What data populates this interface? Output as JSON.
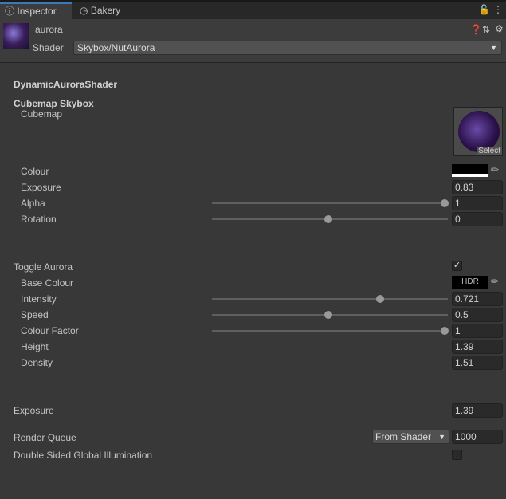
{
  "tabs": [
    {
      "label": "Inspector",
      "icon": "info-icon"
    },
    {
      "label": "Bakery",
      "icon": "bakery-icon"
    }
  ],
  "header": {
    "name": "aurora",
    "shader_label": "Shader",
    "shader_value": "Skybox/NutAurora"
  },
  "sections": {
    "title": "DynamicAuroraShader",
    "cubemap_skybox": "Cubemap Skybox",
    "cubemap": "Cubemap",
    "select": "Select"
  },
  "props": {
    "colour": {
      "label": "Colour",
      "color": "#000000"
    },
    "exposure": {
      "label": "Exposure",
      "value": "0.83"
    },
    "alpha": {
      "label": "Alpha",
      "value": "1",
      "fraction": 1
    },
    "rotation": {
      "label": "Rotation",
      "value": "0",
      "fraction": 0.5
    },
    "toggle_aurora": {
      "label": "Toggle Aurora",
      "checked": true,
      "check": "✓"
    },
    "base_colour": {
      "label": "Base Colour",
      "value": "HDR"
    },
    "intensity": {
      "label": "Intensity",
      "value": "0.721",
      "fraction": 0.721
    },
    "speed": {
      "label": "Speed",
      "value": "0.5",
      "fraction": 0.5
    },
    "colour_factor": {
      "label": "Colour Factor",
      "value": "1",
      "fraction": 1
    },
    "height": {
      "label": "Height",
      "value": "1.39"
    },
    "density": {
      "label": "Density",
      "value": "1.51"
    },
    "exposure2": {
      "label": "Exposure",
      "value": "1.39"
    },
    "render_queue": {
      "label": "Render Queue",
      "mode": "From Shader",
      "value": "1000"
    },
    "dsgi": {
      "label": "Double Sided Global Illumination",
      "checked": false
    }
  }
}
